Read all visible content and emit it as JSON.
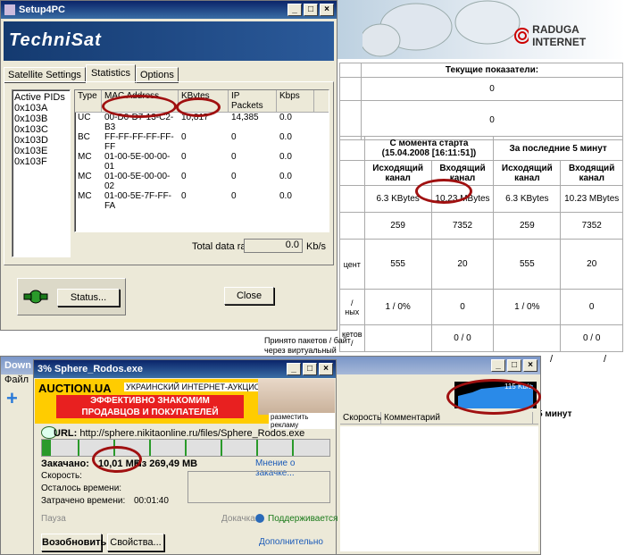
{
  "setup_window": {
    "title": "Setup4PC",
    "logo": "TechniSat",
    "tabs": [
      "Satellite Settings",
      "Statistics",
      "Options"
    ],
    "active_tab": "Statistics",
    "pids_header": "Active PIDs",
    "pids": [
      "0x103A",
      "0x103B",
      "0x103C",
      "0x103D",
      "0x103E",
      "0x103F"
    ],
    "table_headers": [
      "Type",
      "MAC Address",
      "KBytes",
      "IP Packets",
      "Kbps"
    ],
    "rows": [
      [
        "UC",
        "00-D0-D7-13-C2-B3",
        "10,817",
        "14,385",
        "0.0"
      ],
      [
        "BC",
        "FF-FF-FF-FF-FF-FF",
        "0",
        "0",
        "0.0"
      ],
      [
        "MC",
        "01-00-5E-00-00-01",
        "0",
        "0",
        "0.0"
      ],
      [
        "MC",
        "01-00-5E-00-00-02",
        "0",
        "0",
        "0.0"
      ],
      [
        "MC",
        "01-00-5E-7F-FF-FA",
        "0",
        "0",
        "0.0"
      ]
    ],
    "total_label": "Total data rate:",
    "total_value": "0.0",
    "total_unit": "Kb/s",
    "status_button": "Status...",
    "close_button": "Close"
  },
  "raduga": {
    "brand": "RADUGA INTERNET",
    "current_header": "Текущие показатели:",
    "current_values": [
      "0",
      "0"
    ],
    "since_start": "С момента старта",
    "since_date": "(15.04.2008 [16:11:51])",
    "last5": "За последние 5 минут",
    "outgoing": "Исходящий канал",
    "incoming": "Входящий канал",
    "rows": [
      [
        "6.3 KBytes",
        "10.23 MBytes",
        "6.3 KBytes",
        "10.23 MBytes"
      ],
      [
        "259",
        "7352",
        "259",
        "7352"
      ],
      [
        "555",
        "20",
        "555",
        "20"
      ],
      [
        "1 / 0%",
        "0",
        "1 / 0%",
        "0"
      ],
      [
        "",
        "0 / 0",
        "",
        "0 / 0"
      ]
    ],
    "left_snips": [
      "/",
      "ных",
      "кетов /",
      "цент"
    ],
    "packets_label": "Принято пакетов / байт через виртуальный",
    "slash": "/",
    "last5_bottom": "5 минут"
  },
  "download_window": {
    "title": "3% Sphere_Rodos.exe",
    "bg_title": "Down",
    "bg_menu": "Файл",
    "ad_title": "AUCTION.UA",
    "ad_subtitle": "УКРАИНСКИЙ ИНТЕРНЕТ-АУКЦИОН",
    "ad_line1": "ЭФФЕКТИВНО ЗНАКОМИМ",
    "ad_line2": "ПРОДАВЦОВ И ПОКУПАТЕЛЕЙ",
    "ad_link": "разместить рекламу",
    "url_label": "URL:",
    "url": "http://sphere.nikitaonline.ru/files/Sphere_Rodos.exe",
    "downloaded_label": "Закачано:",
    "downloaded_value": "10,01 MB",
    "downloaded_of": "из 269,49 MB",
    "opinion_link": "Мнение о закачке...",
    "speed_label": "Скорость:",
    "remaining_label": "Осталось времени:",
    "elapsed_label": "Затрачено времени:",
    "elapsed_value": "00:01:40",
    "pause": "Пауза",
    "resume_label": "Докачка:",
    "resume_value": "Поддерживается",
    "resume_button": "Возобновить",
    "props_button": "Свойства...",
    "more_link": "Дополнительно",
    "graph_speed": "115 Kb/s",
    "progress": 0.03,
    "list_headers": [
      "Скорость",
      "Комментарий"
    ]
  }
}
